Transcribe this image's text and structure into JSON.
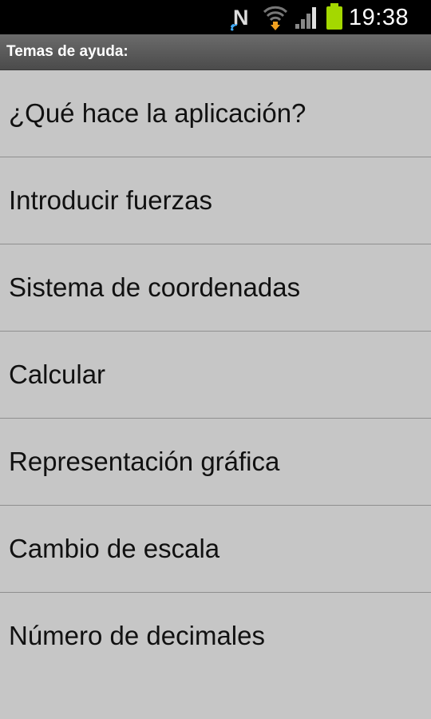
{
  "status_bar": {
    "time": "19:38",
    "icons": [
      "nfc-icon",
      "wifi-icon",
      "signal-icon",
      "battery-icon"
    ],
    "battery_color": "#a4d800"
  },
  "header": {
    "title": "Temas de ayuda:"
  },
  "help_topics": [
    {
      "label": "¿Qué hace la aplicación?"
    },
    {
      "label": "Introducir fuerzas"
    },
    {
      "label": "Sistema de coordenadas"
    },
    {
      "label": "Calcular"
    },
    {
      "label": "Representación gráfica"
    },
    {
      "label": "Cambio de escala"
    },
    {
      "label": "Número de decimales"
    }
  ],
  "colors": {
    "background": "#c6c6c6",
    "divider": "#8f8f8f",
    "status_bar": "#000000",
    "title_bar": "#5a5a5a"
  }
}
